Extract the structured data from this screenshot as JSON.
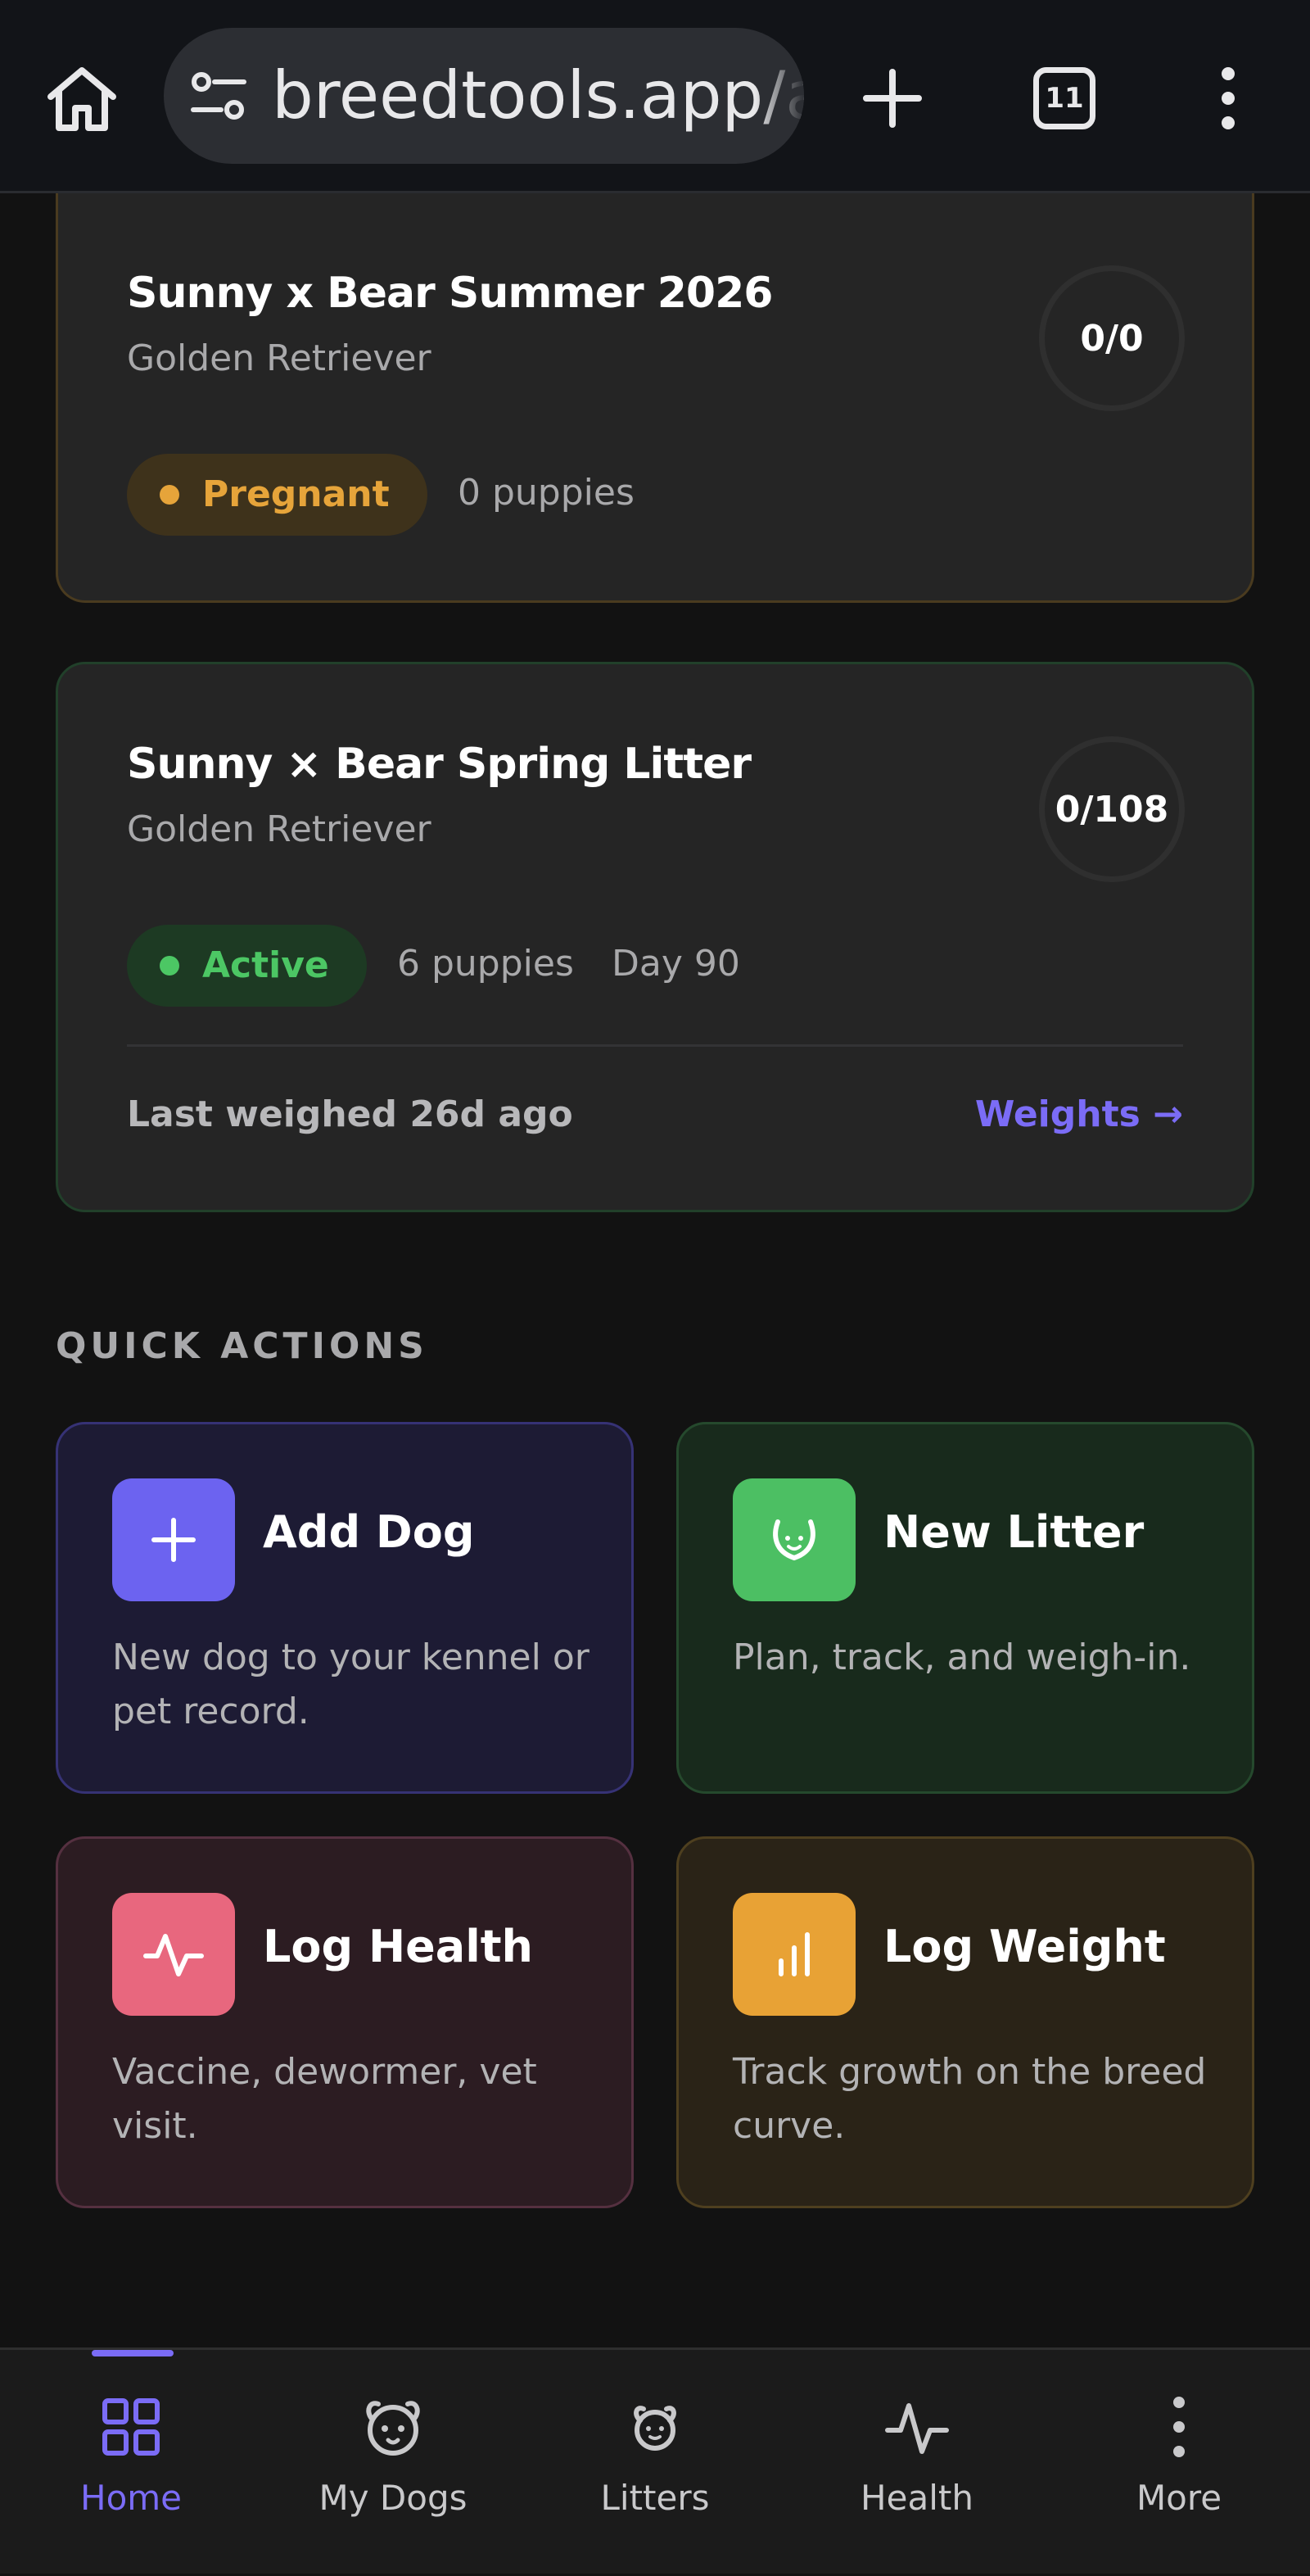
{
  "browser": {
    "url": "breedtools.app/a",
    "tab_count": "11"
  },
  "litters": [
    {
      "title": "Sunny x Bear Summer 2026",
      "breed": "Golden Retriever",
      "progress": "0/0",
      "status": "Pregnant",
      "puppies": "0 puppies"
    },
    {
      "title": "Sunny × Bear Spring Litter",
      "breed": "Golden Retriever",
      "progress": "0/108",
      "status": "Active",
      "puppies": "6 puppies",
      "day": "Day 90",
      "last_weighed": "Last weighed 26d ago",
      "weights_link": "Weights →"
    }
  ],
  "quick_actions": {
    "title": "QUICK ACTIONS",
    "items": [
      {
        "title": "Add Dog",
        "desc": "New dog to your kennel or pet record.",
        "icon": "plus-icon"
      },
      {
        "title": "New Litter",
        "desc": "Plan, track, and weigh-in.",
        "icon": "puppy-icon"
      },
      {
        "title": "Log Health",
        "desc": "Vaccine, dewormer, vet visit.",
        "icon": "pulse-icon"
      },
      {
        "title": "Log Weight",
        "desc": "Track growth on the breed curve.",
        "icon": "bar-chart-icon"
      }
    ]
  },
  "nav": {
    "items": [
      {
        "label": "Home",
        "icon": "grid-icon",
        "active": true
      },
      {
        "label": "My Dogs",
        "icon": "dog-icon"
      },
      {
        "label": "Litters",
        "icon": "puppy-icon"
      },
      {
        "label": "Health",
        "icon": "pulse-icon"
      },
      {
        "label": "More",
        "icon": "more-vertical-icon"
      }
    ]
  },
  "colors": {
    "accent": "#7b6cf6",
    "pregnant": "#e6a43a",
    "active": "#4cc764",
    "background": "#121212"
  }
}
